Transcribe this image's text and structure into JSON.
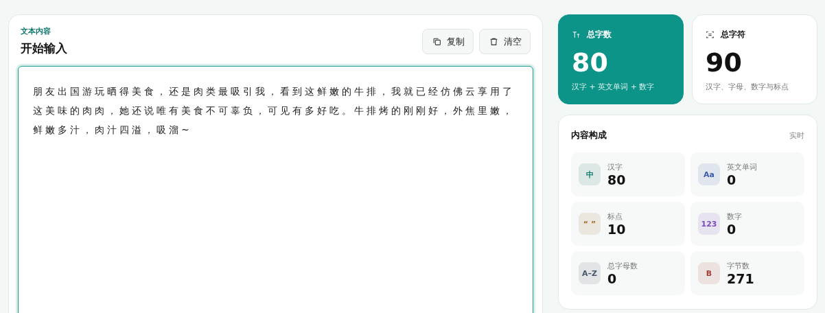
{
  "editor": {
    "eyebrow": "文本内容",
    "title": "开始输入",
    "buttons": [
      {
        "kind": "copy",
        "label": "复制"
      },
      {
        "kind": "clear",
        "label": "清空"
      }
    ],
    "value": "朋友出国游玩晒得美食，还是肉类最吸引我，看到这鲜嫩的牛排，我就已经仿佛云享用了这美味的肉肉，她还说唯有美食不可辜负，可见有多好吃。牛排烤的刚刚好，外焦里嫩，鲜嫩多汁，肉汁四溢，吸溜~"
  },
  "summary": [
    {
      "kind": "primary",
      "label": "总字数",
      "value": "80",
      "note": "汉字 + 英文单词 + 数字"
    },
    {
      "kind": "plain",
      "label": "总字符",
      "value": "90",
      "note": "汉字、字母、数字与标点"
    }
  ],
  "composition": {
    "title": "内容构成",
    "badge": "实时",
    "items": [
      {
        "icon": "中",
        "label": "汉字",
        "value": "80",
        "color": "#0f766e"
      },
      {
        "icon": "Aa",
        "label": "英文单词",
        "value": "0",
        "color": "#3b5bab"
      },
      {
        "icon": "“ ”",
        "label": "标点",
        "value": "10",
        "color": "#9a6a2a"
      },
      {
        "icon": "123",
        "label": "数字",
        "value": "0",
        "color": "#7c4dbb"
      },
      {
        "icon": "A–Z",
        "label": "总字母数",
        "value": "0",
        "color": "#475569"
      },
      {
        "icon": "B",
        "label": "字节数",
        "value": "271",
        "color": "#a0413a"
      }
    ]
  }
}
